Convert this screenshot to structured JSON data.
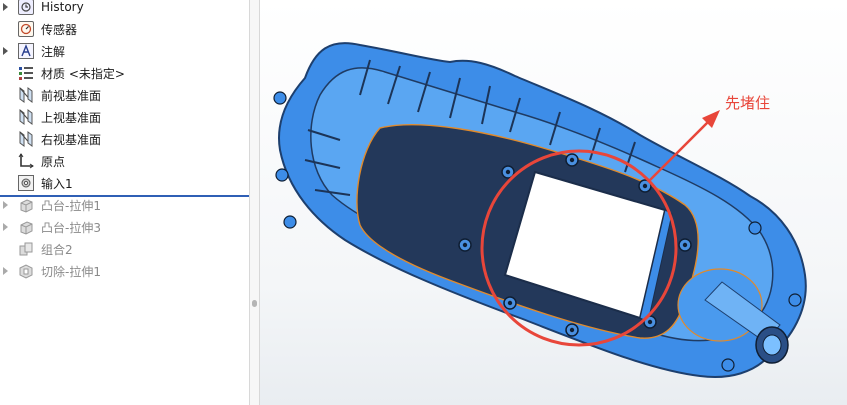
{
  "tree": {
    "items": [
      {
        "label": "History",
        "icon": "history-icon",
        "expander": true
      },
      {
        "label": "传感器",
        "icon": "sensor-icon",
        "expander": false
      },
      {
        "label": "注解",
        "icon": "annotation-icon",
        "expander": true
      },
      {
        "label": "材质 <未指定>",
        "icon": "material-icon",
        "expander": false
      },
      {
        "label": "前视基准面",
        "icon": "plane-icon",
        "expander": false
      },
      {
        "label": "上视基准面",
        "icon": "plane-icon",
        "expander": false
      },
      {
        "label": "右视基准面",
        "icon": "plane-icon",
        "expander": false
      },
      {
        "label": "原点",
        "icon": "origin-icon",
        "expander": false
      },
      {
        "label": "输入1",
        "icon": "import-icon",
        "expander": false
      },
      {
        "label": "凸台-拉伸1",
        "icon": "extrude-icon",
        "expander": true
      },
      {
        "label": "凸台-拉伸3",
        "icon": "extrude-icon",
        "expander": true
      },
      {
        "label": "组合2",
        "icon": "combine-icon",
        "expander": false
      },
      {
        "label": "切除-拉伸1",
        "icon": "cut-extrude-icon",
        "expander": true
      }
    ]
  },
  "viewport": {
    "annotation_text": "先堵住",
    "colors": {
      "model_blue": "#3c8ae6",
      "model_dark": "#1f3556",
      "edge_orange": "#e08a2c",
      "annotation_red": "#e8463a"
    }
  }
}
